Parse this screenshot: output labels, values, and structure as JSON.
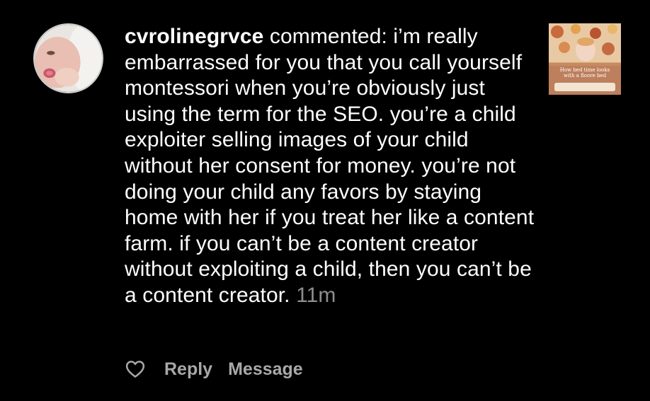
{
  "comment": {
    "username": "cvrolinegrvce",
    "action_text": "commented:",
    "body": "i’m really embarrassed for you that you call yourself montessori when you’re obviously just using the term for the SEO. you’re a child exploiter selling images of your child without her consent for money. you’re not doing your child any favors by staying home with her if you treat her like a content farm. if you can’t be a content creator without exploiting a child, then you can’t be a content creator.",
    "timestamp": "11m"
  },
  "thumbnail": {
    "caption": "How bed time looks with a floore bed"
  },
  "actions": {
    "like_icon": "heart-outline-icon",
    "reply_label": "Reply",
    "message_label": "Message"
  },
  "colors": {
    "background": "#000000",
    "text": "#ffffff",
    "muted": "#8e8e8e",
    "action": "#a8a8a8"
  }
}
